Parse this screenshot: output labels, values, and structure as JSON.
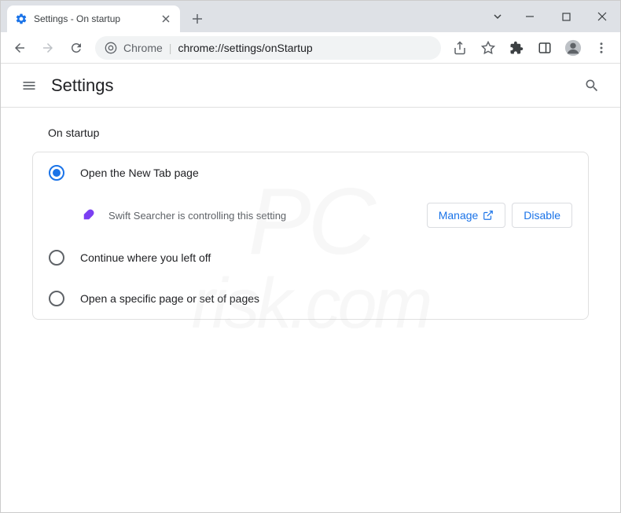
{
  "tab": {
    "title": "Settings - On startup"
  },
  "address": {
    "prefix": "Chrome",
    "url": "chrome://settings/onStartup"
  },
  "settings_header": {
    "title": "Settings"
  },
  "section": {
    "title": "On startup",
    "options": [
      {
        "label": "Open the New Tab page",
        "selected": true
      },
      {
        "label": "Continue where you left off",
        "selected": false
      },
      {
        "label": "Open a specific page or set of pages",
        "selected": false
      }
    ],
    "extension_notice": {
      "text": "Swift Searcher is controlling this setting",
      "manage_label": "Manage",
      "disable_label": "Disable"
    }
  },
  "watermark": {
    "line1": "PC",
    "line2": "risk.com"
  }
}
